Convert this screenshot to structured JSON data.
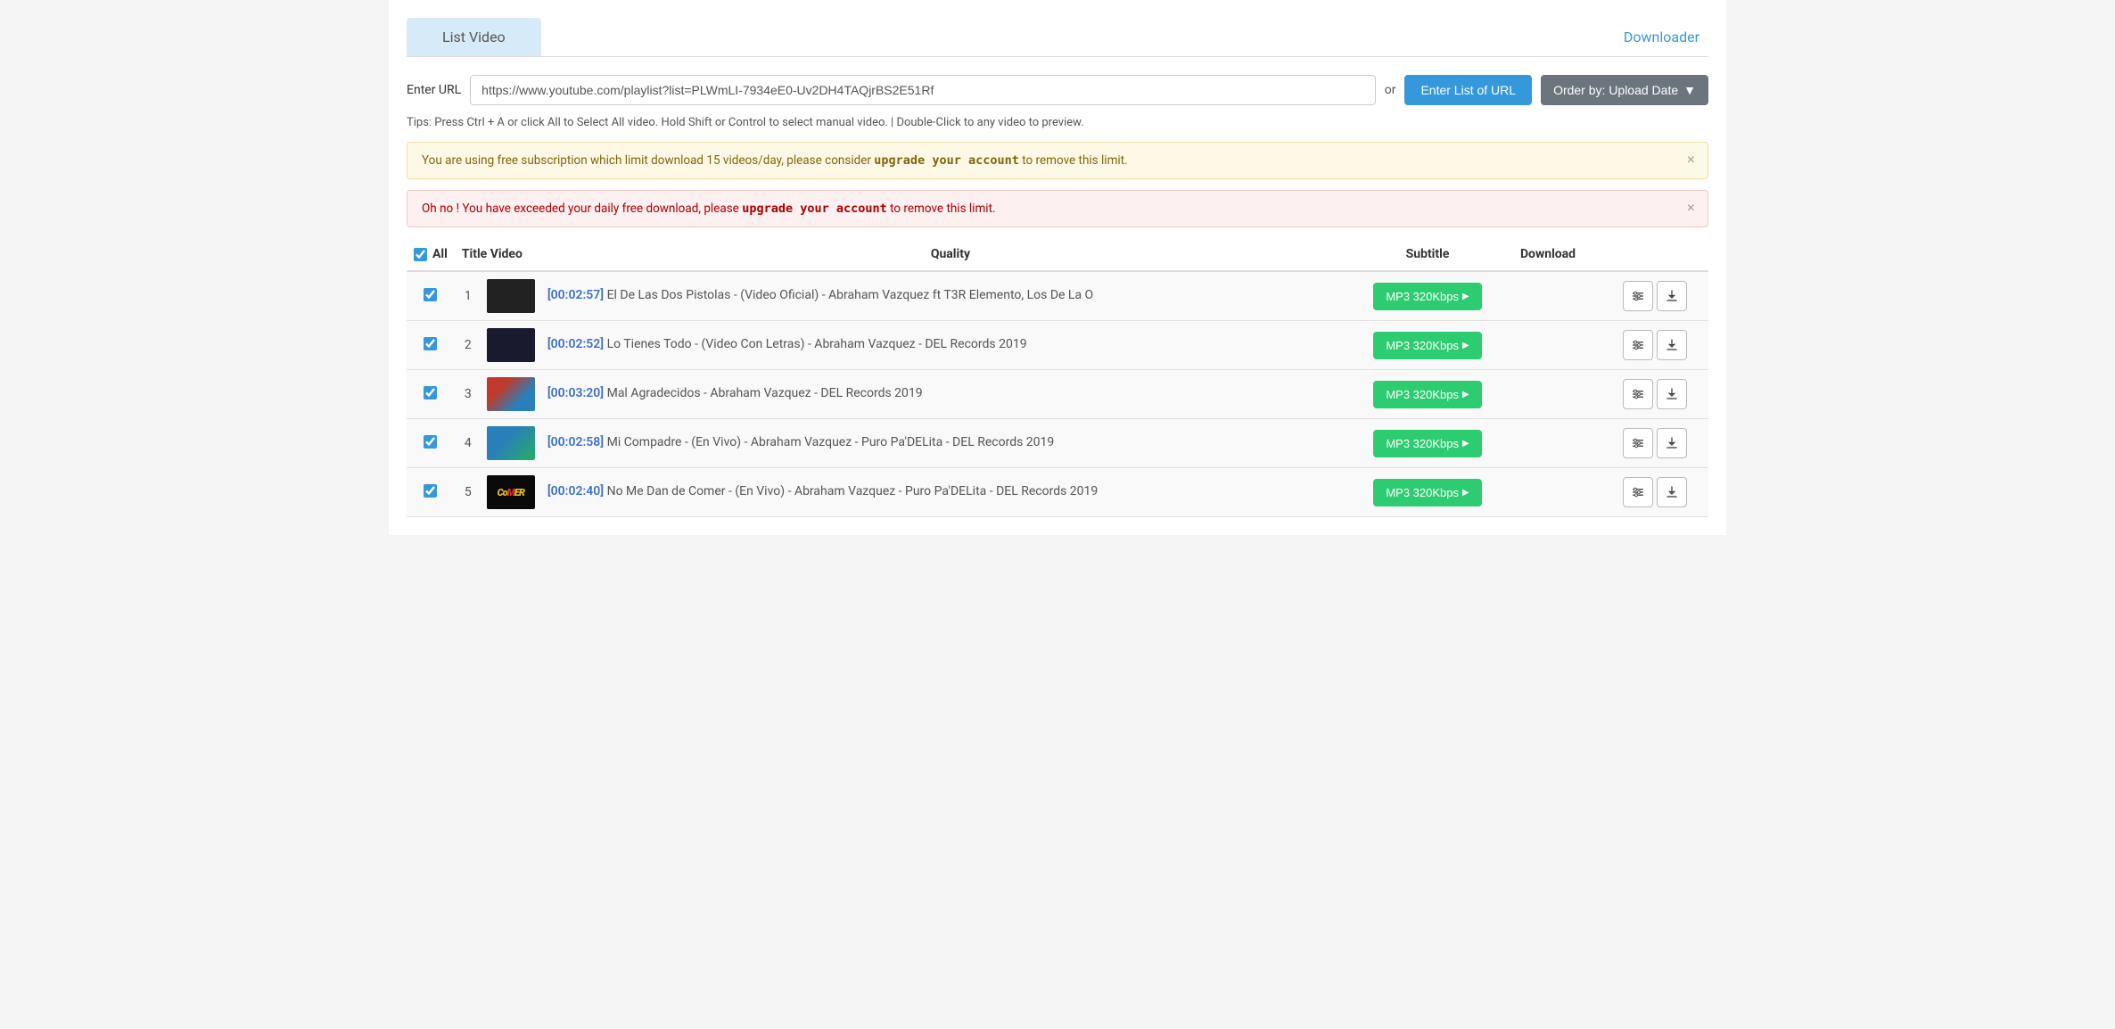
{
  "tabs": [
    {
      "id": "list-video",
      "label": "List Video",
      "active": true
    },
    {
      "id": "downloader",
      "label": "Downloader",
      "active": false
    }
  ],
  "url_section": {
    "label": "Enter URL",
    "url_value": "https://www.youtube.com/playlist?list=PLWmLI-7934eE0-Uv2DH4TAQjrBS2E51Rf",
    "or_text": "or",
    "enter_list_btn": "Enter List of URL",
    "order_btn": "Order by: Upload Date"
  },
  "tips": "Tips: Press Ctrl + A or click All to Select All video. Hold Shift or Control to select manual video. | Double-Click to any video to preview.",
  "alerts": [
    {
      "type": "warning",
      "text_before": "You are using free subscription which limit download 15 videos/day, please consider ",
      "text_bold": "upgrade your account",
      "text_after": " to remove this limit."
    },
    {
      "type": "danger",
      "text_before": "Oh no ! You have exceeded your daily free download, please ",
      "text_bold": "upgrade your account",
      "text_after": " to remove this limit."
    }
  ],
  "table": {
    "headers": {
      "all_checkbox": true,
      "all_label": "All",
      "title_label": "Title Video",
      "quality_label": "Quality",
      "subtitle_label": "Subtitle",
      "download_label": "Download"
    },
    "rows": [
      {
        "num": 1,
        "checked": true,
        "thumb_type": "dark",
        "time": "[00:02:57]",
        "title": "El De Las Dos Pistolas - (Video Oficial) - Abraham Vazquez ft T3R Elemento, Los De La O",
        "quality": "MP3 320Kbps"
      },
      {
        "num": 2,
        "checked": true,
        "thumb_type": "dark",
        "time": "[00:02:52]",
        "title": "Lo Tienes Todo - (Video Con Letras) - Abraham Vazquez - DEL Records 2019",
        "quality": "MP3 320Kbps"
      },
      {
        "num": 3,
        "checked": true,
        "thumb_type": "colorful",
        "time": "[00:03:20]",
        "title": "Mal Agradecidos - Abraham Vazquez - DEL Records 2019",
        "quality": "MP3 320Kbps"
      },
      {
        "num": 4,
        "checked": true,
        "thumb_type": "group",
        "time": "[00:02:58]",
        "title": "Mi Compadre - (En Vivo) - Abraham Vazquez - Puro Pa'DELita - DEL Records 2019",
        "quality": "MP3 320Kbps"
      },
      {
        "num": 5,
        "checked": true,
        "thumb_type": "comer",
        "time": "[00:02:40]",
        "title": "No Me Dan de Comer - (En Vivo) - Abraham Vazquez - Puro Pa'DELita - DEL Records 2019",
        "quality": "MP3 320Kbps"
      }
    ]
  },
  "icons": {
    "close": "×",
    "download": "↓",
    "settings": "⚙",
    "chevron_down": "▼"
  }
}
